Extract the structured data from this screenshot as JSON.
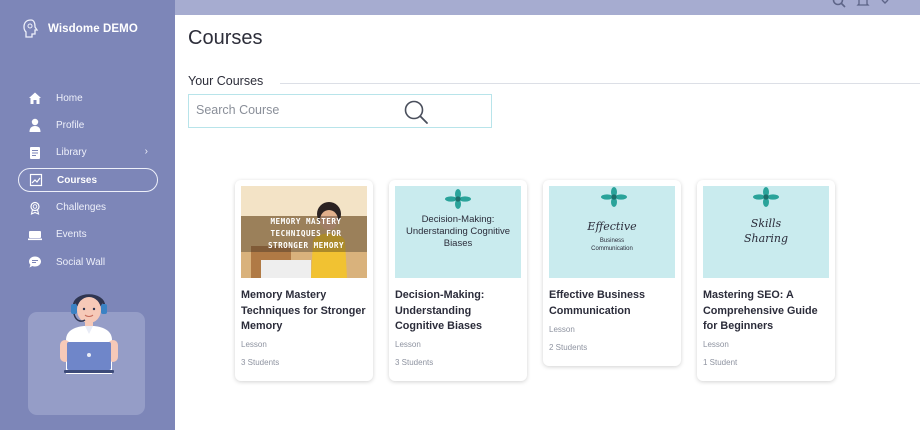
{
  "app": {
    "brand": "Wisdome DEMO"
  },
  "sidebar": {
    "items": [
      {
        "label": "Home",
        "icon": "home-icon"
      },
      {
        "label": "Profile",
        "icon": "user-icon"
      },
      {
        "label": "Library",
        "icon": "library-icon",
        "has_submenu": true
      },
      {
        "label": "Courses",
        "icon": "courses-icon",
        "active": true
      },
      {
        "label": "Challenges",
        "icon": "award-icon"
      },
      {
        "label": "Events",
        "icon": "events-icon"
      },
      {
        "label": "Social Wall",
        "icon": "chat-icon"
      }
    ]
  },
  "page": {
    "title": "Courses"
  },
  "section": {
    "title": "Your Courses"
  },
  "search": {
    "placeholder": "Search Course"
  },
  "courses": [
    {
      "title": "Memory Mastery Techniques for Stronger Memory",
      "type": "Lesson",
      "students": "3 Students",
      "thumb_text": "MEMORY MASTERY TECHNIQUES FOR STRONGER MEMORY"
    },
    {
      "title": "Decision-Making: Understanding Cognitive Biases",
      "type": "Lesson",
      "students": "3 Students",
      "thumb_text": "Decision-Making: Understanding Cognitive Biases"
    },
    {
      "title": "Effective Business Communication",
      "type": "Lesson",
      "students": "2 Students",
      "thumb_text_script": "Effective",
      "thumb_text_small": "Business Communication"
    },
    {
      "title": "Mastering SEO: A Comprehensive Guide for Beginners",
      "type": "Lesson",
      "students": "1 Student",
      "thumb_text_script": "Skills Sharing"
    }
  ],
  "colors": {
    "sidebar": "#7d86b8",
    "thumb_bg": "#c9ebee",
    "accent_teal": "#2aa39a"
  }
}
